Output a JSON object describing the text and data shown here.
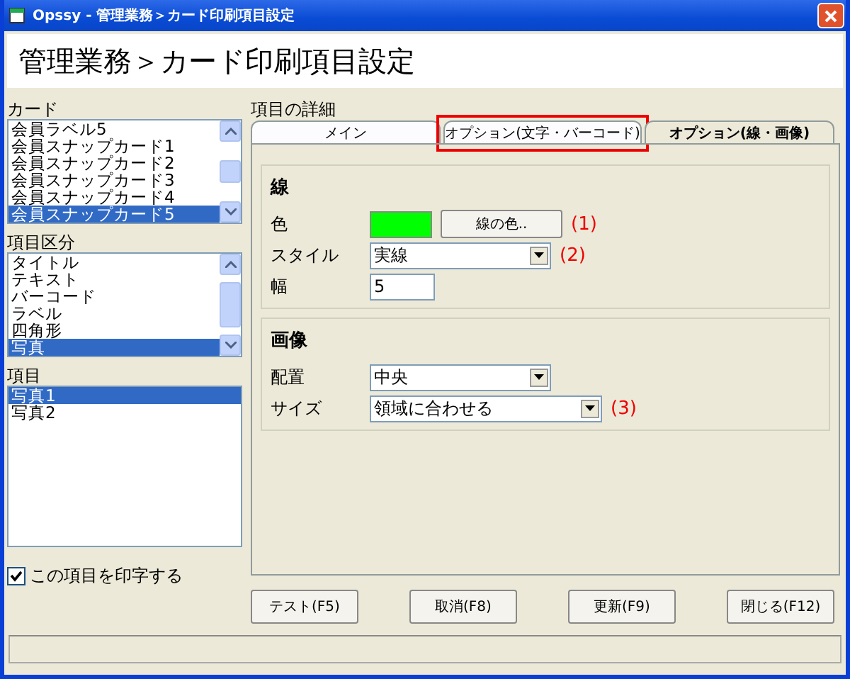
{
  "window": {
    "title": "Opssy - 管理業務＞カード印刷項目設定"
  },
  "header": {
    "title": "管理業務＞カード印刷項目設定"
  },
  "lists": [
    {
      "label": "カード",
      "scrollbar": true,
      "items": [
        {
          "text": "会員ラベル5",
          "selected": false
        },
        {
          "text": "会員スナップカード1",
          "selected": false
        },
        {
          "text": "会員スナップカード2",
          "selected": false
        },
        {
          "text": "会員スナップカード3",
          "selected": false
        },
        {
          "text": "会員スナップカード4",
          "selected": false
        },
        {
          "text": "会員スナップカード5",
          "selected": true
        }
      ]
    },
    {
      "label": "項目区分",
      "scrollbar": true,
      "items": [
        {
          "text": "タイトル",
          "selected": false
        },
        {
          "text": "テキスト",
          "selected": false
        },
        {
          "text": "バーコード",
          "selected": false
        },
        {
          "text": "ラベル",
          "selected": false
        },
        {
          "text": "四角形",
          "selected": false
        },
        {
          "text": "写真",
          "selected": true
        }
      ]
    },
    {
      "label": "項目",
      "scrollbar": false,
      "items": [
        {
          "text": "写真1",
          "selected": true
        },
        {
          "text": "写真2",
          "selected": false
        }
      ]
    }
  ],
  "print_checkbox": {
    "label": "この項目を印字する",
    "checked": true
  },
  "details": {
    "label": "項目の詳細",
    "tabs": [
      {
        "label": "メイン",
        "selected": false,
        "annotated": false
      },
      {
        "label": "オプション(文字・バーコード)",
        "selected": false,
        "annotated": true
      },
      {
        "label": "オプション(線・画像)",
        "selected": true,
        "annotated": false
      }
    ],
    "groups": [
      {
        "title": "線",
        "rows": [
          {
            "kind": "color",
            "label": "色",
            "color": "#00ff00",
            "button": "線の色..",
            "note": "(1)"
          },
          {
            "kind": "select",
            "label": "スタイル",
            "value": "実線",
            "note": "(2)",
            "wide": false
          },
          {
            "kind": "input",
            "label": "幅",
            "value": "5"
          }
        ]
      },
      {
        "title": "画像",
        "rows": [
          {
            "kind": "select",
            "label": "配置",
            "value": "中央",
            "wide": false
          },
          {
            "kind": "select",
            "label": "サイズ",
            "value": "領域に合わせる",
            "note": "(3)",
            "wide": true
          }
        ]
      }
    ]
  },
  "buttons": [
    "テスト(F5)",
    "取消(F8)",
    "更新(F9)",
    "閉じる(F12)"
  ]
}
